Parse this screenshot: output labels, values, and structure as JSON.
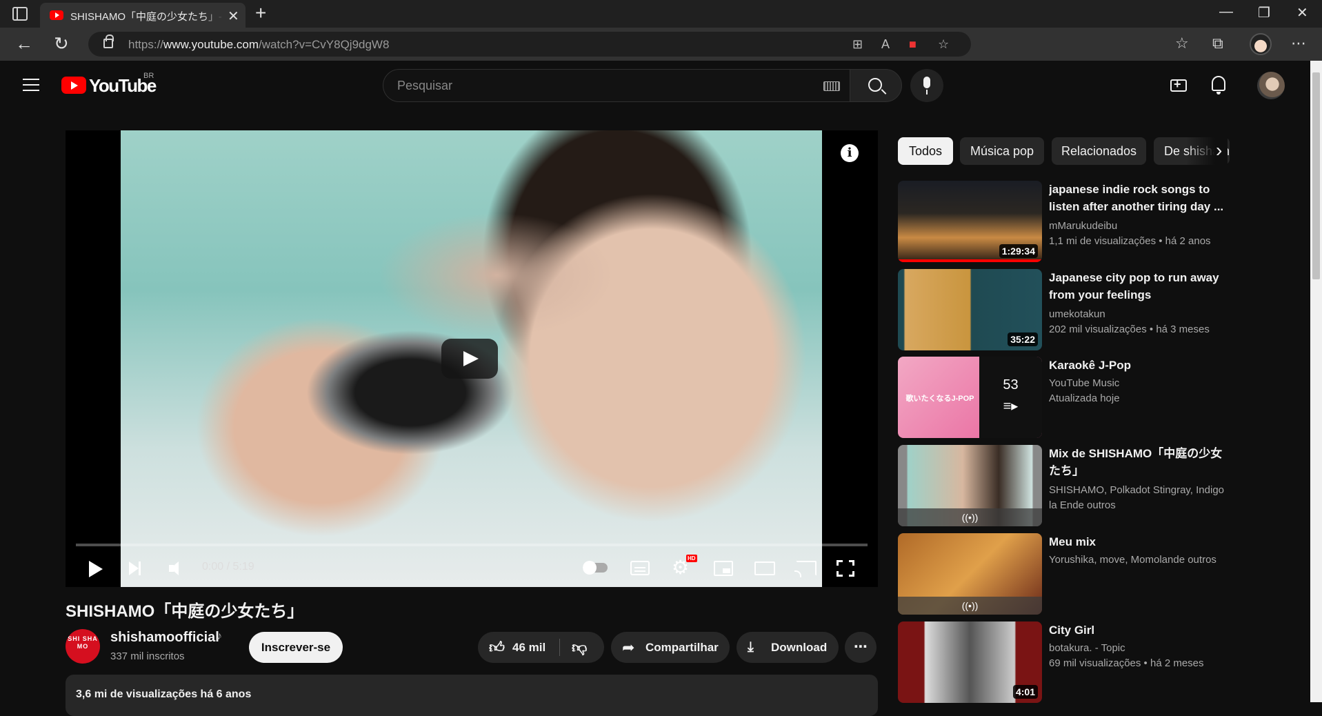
{
  "browser": {
    "tab_title": "SHISHAMO「中庭の少女たち」- YouTube",
    "url_prefix": "https://",
    "url_host": "www.youtube.com",
    "url_path": "/watch?v=CvY8Qj9dgW8"
  },
  "header": {
    "logo_text": "YouTube",
    "country_code": "BR",
    "search_placeholder": "Pesquisar"
  },
  "player": {
    "time": "0:00 / 5:19",
    "hd_badge": "HD"
  },
  "video": {
    "title": "SHISHAMO「中庭の少女たち」",
    "channel_name": "shishamoofficial",
    "channel_badge": "♪",
    "channel_avatar_text": "SHI SHA MO",
    "subscribers": "337 mil inscritos",
    "subscribe_label": "Inscrever-se",
    "likes": "46 mil",
    "share_label": "Compartilhar",
    "download_label": "Download",
    "views_and_date": "3,6 mi de visualizações  há 6 anos"
  },
  "chips": [
    "Todos",
    "Música pop",
    "Relacionados",
    "De shishamoofficial"
  ],
  "recommendations": [
    {
      "title": "japanese indie rock songs to listen after another tiring day ...",
      "channel": "mMarukudeibu",
      "stats": "1,1 mi de visualizações  • há 2 anos",
      "duration": "1:29:34"
    },
    {
      "title": "Japanese city pop to run away from your feelings",
      "channel": "umekotakun",
      "stats": "202 mil visualizações  • há 3 meses",
      "duration": "35:22"
    },
    {
      "title": "Karaokê J-Pop",
      "channel": "YouTube Music",
      "stats": "Atualizada hoje",
      "count": "53",
      "thumb_text": "歌いたくなるJ-POP"
    },
    {
      "title": "Mix de SHISHAMO「中庭の少女たち」",
      "channel": "SHISHAMO, Polkadot Stingray, Indigo la Ende outros"
    },
    {
      "title": "Meu mix",
      "channel": "Yorushika, move, Momolande outros"
    },
    {
      "title": "City Girl",
      "channel": "botakura. - Topic",
      "stats": "69 mil visualizações  • há 2 meses",
      "duration": "4:01"
    }
  ],
  "colors": {
    "brand_red": "#ff0000",
    "background": "#0f0f0f",
    "chip_bg": "#272727"
  }
}
